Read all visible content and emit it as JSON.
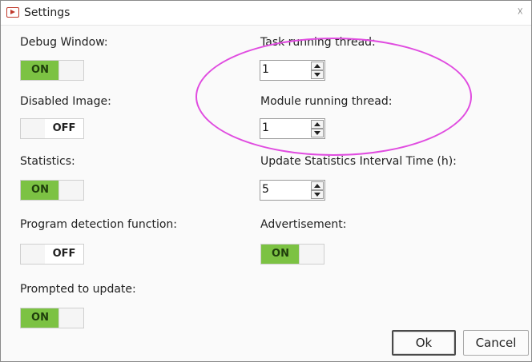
{
  "window": {
    "title": "Settings",
    "close_glyph": "☓"
  },
  "left": {
    "debug_window": {
      "label": "Debug Window:",
      "state": "ON"
    },
    "disabled_image": {
      "label": "Disabled Image:",
      "state": "OFF"
    },
    "statistics": {
      "label": "Statistics:",
      "state": "ON"
    },
    "program_detection": {
      "label": "Program detection function:",
      "state": "OFF"
    },
    "prompted_update": {
      "label": "Prompted to update:",
      "state": "ON"
    }
  },
  "right": {
    "task_thread": {
      "label": "Task running thread:",
      "value": "1"
    },
    "module_thread": {
      "label": "Module running thread:",
      "value": "1"
    },
    "stats_interval": {
      "label": "Update Statistics Interval Time (h):",
      "value": "5"
    },
    "advertisement": {
      "label": "Advertisement:",
      "state": "ON"
    }
  },
  "buttons": {
    "ok": "Ok",
    "cancel": "Cancel"
  },
  "colors": {
    "toggle_on": "#7cc243",
    "annotation": "#e04ce0",
    "close_icon": "#c0392b"
  }
}
